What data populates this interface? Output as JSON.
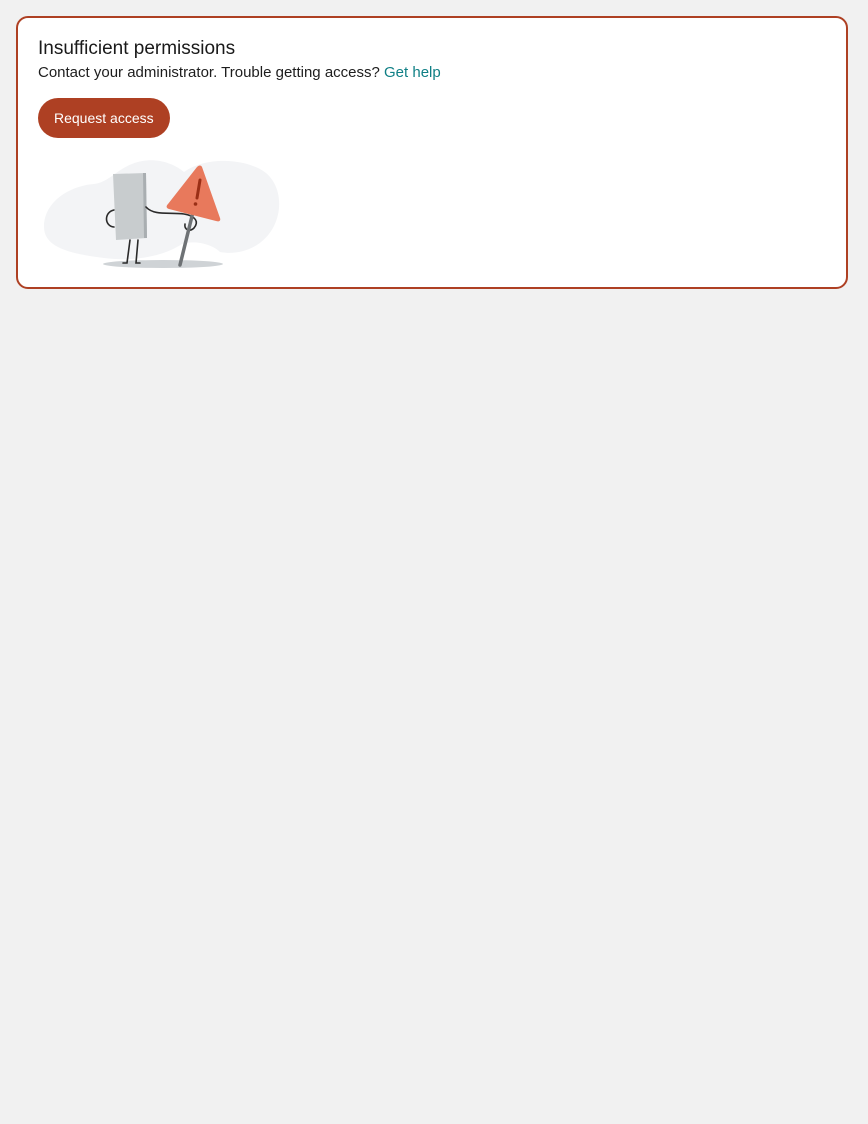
{
  "error_card": {
    "title": "Insufficient permissions",
    "message": "Contact your administrator. Trouble getting access?",
    "help_link_label": "Get help",
    "request_button_label": "Request access",
    "illustration": "warning-sign-character-illustration",
    "colors": {
      "accent": "#ae4023",
      "link": "#0f7f85",
      "warning_sign": "#e8795c",
      "page_background": "#f1f1f1"
    }
  }
}
